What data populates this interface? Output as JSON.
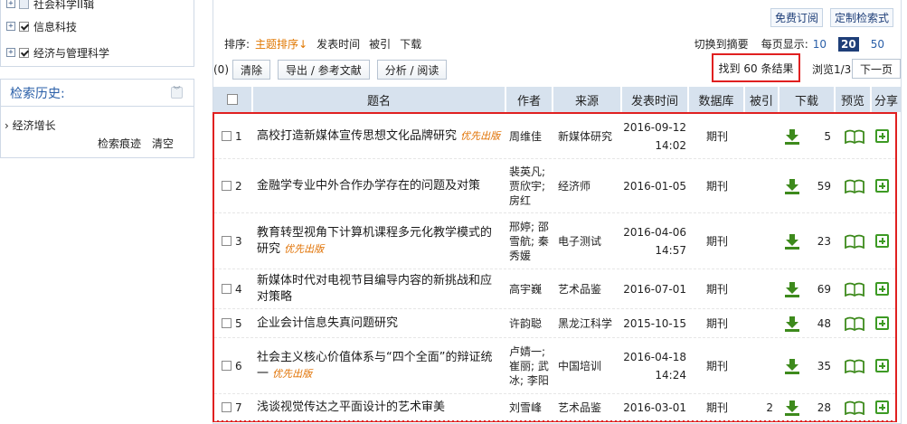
{
  "sidebar": {
    "categories": [
      {
        "label": "社会科学II辑",
        "checked": false
      },
      {
        "label": "信息科技",
        "checked": true
      },
      {
        "label": "经济与管理科学",
        "checked": true
      }
    ],
    "history": {
      "title": "检索历史:",
      "items": [
        "经济增长"
      ],
      "trace_label": "检索痕迹",
      "clear_label": "清空"
    }
  },
  "topbar": {
    "subscribe_label": "免费订阅",
    "custom_search_label": "定制检索式"
  },
  "sortbar": {
    "sort_label": "排序:",
    "sort_topic": "主题排序",
    "sort_time": "发表时间",
    "sort_cited": "被引",
    "sort_download": "下载",
    "switch_abstract": "切换到摘要",
    "per_page_label": "每页显示:",
    "per_page_options": [
      "10",
      "20",
      "50"
    ],
    "per_page_selected": "20"
  },
  "actions": {
    "selected_count": "(0)",
    "clear": "清除",
    "export": "导出 / 参考文献",
    "analyze": "分析 / 阅读",
    "found": "找到 60 条结果",
    "page_info": "浏览1/3",
    "next_page": "下一页"
  },
  "table": {
    "headers": {
      "title": "题名",
      "author": "作者",
      "source": "来源",
      "time": "发表时间",
      "database": "数据库",
      "cited": "被引",
      "download": "下载",
      "preview": "预览",
      "share": "分享"
    },
    "priority_tag": "优先出版",
    "rows": [
      {
        "num": "1",
        "title": "高校打造新媒体宣传思想文化品牌研究",
        "priority": true,
        "author": "周维佳",
        "source": "新媒体研究",
        "time": "2016-09-12 14:02",
        "db": "期刊",
        "cited": "",
        "downloads": "5"
      },
      {
        "num": "2",
        "title": "金融学专业中外合作办学存在的问题及对策",
        "priority": false,
        "author": "裴英凡; 贾欣宇; 房红",
        "source": "经济师",
        "time": "2016-01-05",
        "db": "期刊",
        "cited": "",
        "downloads": "59"
      },
      {
        "num": "3",
        "title": "教育转型视角下计算机课程多元化教学模式的研究",
        "priority": true,
        "author": "邢婷; 邵雪航; 秦秀媛",
        "source": "电子测试",
        "time": "2016-04-06 14:57",
        "db": "期刊",
        "cited": "",
        "downloads": "23"
      },
      {
        "num": "4",
        "title": "新媒体时代对电视节目编导内容的新挑战和应对策略",
        "priority": false,
        "author": "高宇巍",
        "source": "艺术品鉴",
        "time": "2016-07-01",
        "db": "期刊",
        "cited": "",
        "downloads": "69"
      },
      {
        "num": "5",
        "title": "企业会计信息失真问题研究",
        "priority": false,
        "author": "许韵聪",
        "source": "黑龙江科学",
        "time": "2015-10-15",
        "db": "期刊",
        "cited": "",
        "downloads": "48"
      },
      {
        "num": "6",
        "title": "社会主义核心价值体系与“四个全面”的辩证统一",
        "priority": true,
        "author": "卢婧一; 崔丽; 武冰; 李阳",
        "source": "中国培训",
        "time": "2016-04-18 14:24",
        "db": "期刊",
        "cited": "",
        "downloads": "35"
      },
      {
        "num": "7",
        "title": "浅谈视觉传达之平面设计的艺术审美",
        "priority": false,
        "author": "刘雪峰",
        "source": "艺术品鉴",
        "time": "2016-03-01",
        "db": "期刊",
        "cited": "2",
        "downloads": "28"
      }
    ]
  }
}
